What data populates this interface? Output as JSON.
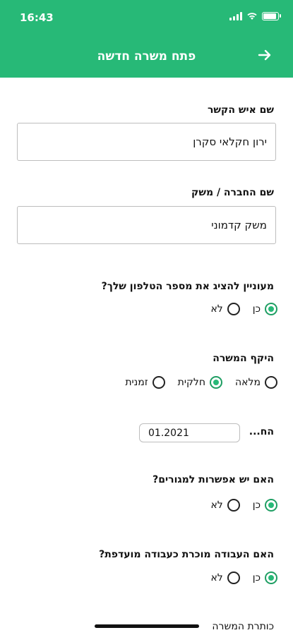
{
  "status_bar": {
    "time": "16:43"
  },
  "header": {
    "title": "פתח משרה חדשה"
  },
  "form": {
    "contact_name": {
      "label": "שם איש הקשר",
      "value": "ירון חקלאי סקרן"
    },
    "company_name": {
      "label": "שם החברה / משק",
      "value": "משק קדמוני"
    },
    "show_phone": {
      "question": "מעוניין להציג את מספר הטלפון שלך?",
      "options": [
        "כן",
        "לא"
      ],
      "selected": "כן"
    },
    "job_scope": {
      "label": "היקף המשרה",
      "options": [
        "מלאה",
        "חלקית",
        "זמנית"
      ],
      "selected": "חלקית"
    },
    "start": {
      "label": "הח...",
      "value": "01.2021"
    },
    "housing": {
      "question": "האם יש אפשרות למגורים?",
      "options": [
        "כן",
        "לא"
      ],
      "selected": "כן"
    },
    "preferred_work": {
      "question": "האם העבודה מוכרת כעבודה מועדפת?",
      "options": [
        "כן",
        "לא"
      ],
      "selected": "כן"
    },
    "job_title": {
      "label": "כותרת המשרה"
    }
  },
  "colors": {
    "accent": "#27b977"
  }
}
